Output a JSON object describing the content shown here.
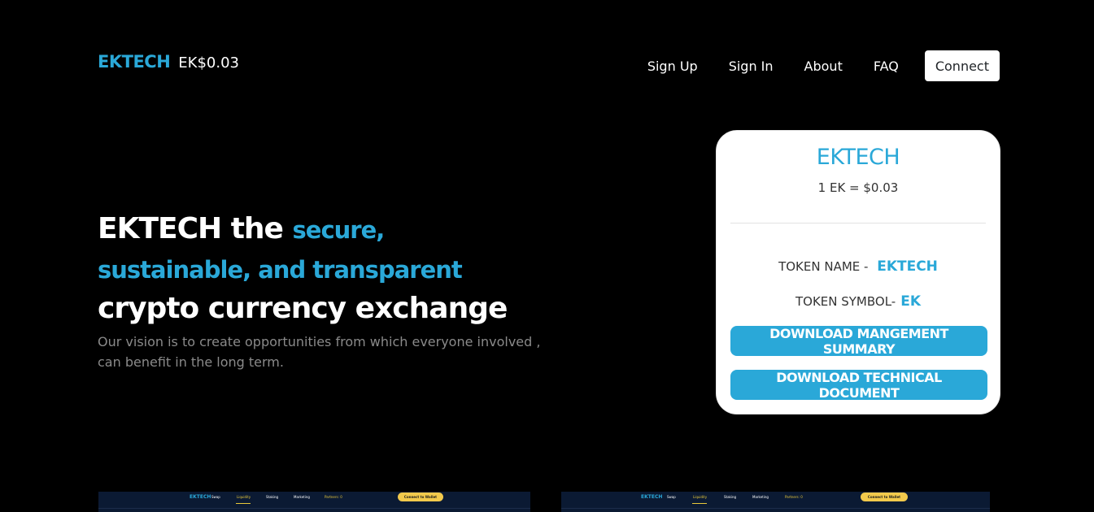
{
  "header": {
    "brand": "EKTECH",
    "price": "EK$0.03",
    "nav": [
      "Sign Up",
      "Sign In",
      "About",
      "FAQ"
    ],
    "connect_label": "Connect"
  },
  "hero": {
    "title_part1": "EKTECH the ",
    "title_highlight1": "secure,",
    "title_highlight2": "sustainable, and transparent",
    "title_part2": "crypto currency exchange",
    "subtitle": "Our vision is to create opportunities from which everyone involved , can benefit in the long term."
  },
  "card": {
    "title": "EKTECH",
    "rate": "1 EK = $0.03",
    "token_name_label": "TOKEN NAME - ",
    "token_name_value": "EKTECH",
    "token_symbol_label": "TOKEN SYMBOL-",
    "token_symbol_value": "EK",
    "btn_summary": "DOWNLOAD MANGEMENT SUMMARY",
    "btn_technical": "DOWNLOAD TECHNICAL DOCUMENT"
  },
  "previews": [
    {
      "brand": "EKTECH",
      "items": [
        "Swap",
        "Liquidity",
        "Staking",
        "Marketing",
        "Partners: 0"
      ],
      "button": "Connect to Wallet"
    },
    {
      "brand": "EKTECH",
      "items": [
        "Swap",
        "Liquidity",
        "Staking",
        "Marketing",
        "Partners: 0"
      ],
      "button": "Connect to Wallet"
    }
  ],
  "colors": {
    "accent": "#2aa8d8",
    "background": "#000000",
    "preview_bg": "#0b1a33",
    "preview_button": "#f2c94c"
  }
}
